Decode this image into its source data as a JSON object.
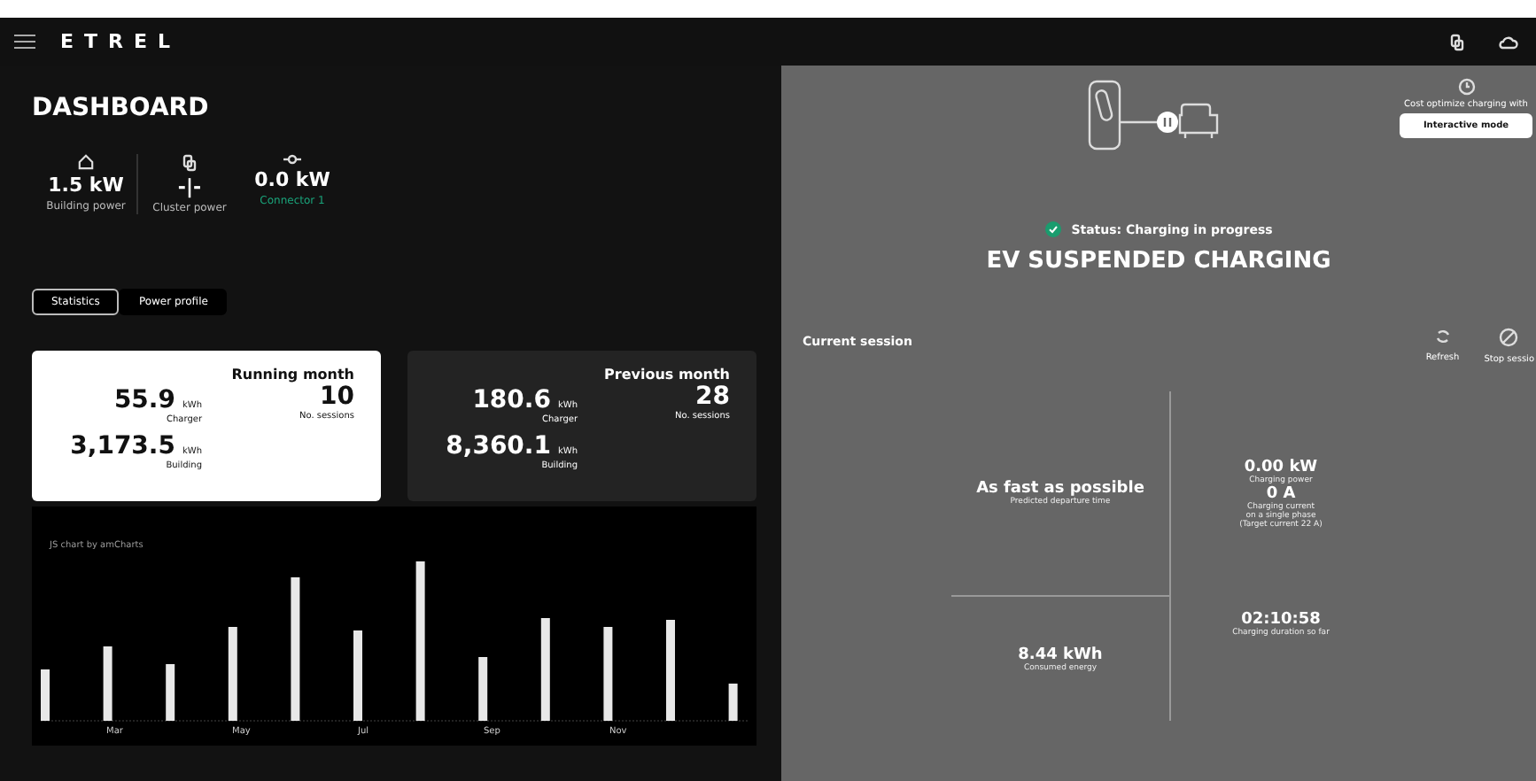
{
  "header": {
    "logo": "ETREL"
  },
  "dashboard": {
    "title": "DASHBOARD",
    "stats": [
      {
        "kind": "building",
        "value": "1.5 kW",
        "label": "Building power",
        "active": false
      },
      {
        "kind": "cluster",
        "value": "-|-",
        "label": "Cluster power",
        "active": false
      },
      {
        "kind": "connector",
        "value": "0.0 kW",
        "label": "Connector 1",
        "active": true
      }
    ],
    "tabs": [
      {
        "label": "Statistics",
        "selected": true
      },
      {
        "label": "Power profile",
        "selected": false
      }
    ],
    "cards": [
      {
        "title": "Running month",
        "selected": true,
        "charger": "55.9",
        "charger_unit": "kWh",
        "charger_label": "Charger",
        "building": "3,173.5",
        "building_unit": "kWh",
        "building_label": "Building",
        "sessions": "10",
        "sessions_label": "No. sessions"
      },
      {
        "title": "Previous month",
        "selected": false,
        "charger": "180.6",
        "charger_unit": "kWh",
        "charger_label": "Charger",
        "building": "8,360.1",
        "building_unit": "kWh",
        "building_label": "Building",
        "sessions": "28",
        "sessions_label": "No. sessions"
      }
    ],
    "chart": {
      "credit": "JS chart by amCharts",
      "x_labels": [
        "Mar",
        "May",
        "Jul",
        "Sep",
        "Nov"
      ]
    }
  },
  "charger": {
    "optimize_text": "Cost optimize charging with",
    "mode_button": "Interactive mode",
    "status": "Status: Charging in progress",
    "status_ok": true,
    "state": "EV SUSPENDED CHARGING",
    "session": {
      "title": "Current session",
      "actions": [
        {
          "kind": "refresh",
          "label": "Refresh"
        },
        {
          "kind": "stop",
          "label": "Stop sessio"
        }
      ],
      "departure": {
        "value": "As fast as possible",
        "label": "Predicted departure time"
      },
      "power": {
        "value": "0.00 kW",
        "label": "Charging power"
      },
      "current": {
        "value": "0 A",
        "label_lines": [
          "Charging current",
          "on a single phase",
          "(Target current 22 A)"
        ]
      },
      "energy": {
        "value": "8.44 kWh",
        "label": "Consumed energy"
      },
      "duration": {
        "value": "02:10:58",
        "label": "Charging duration so far"
      }
    }
  }
}
